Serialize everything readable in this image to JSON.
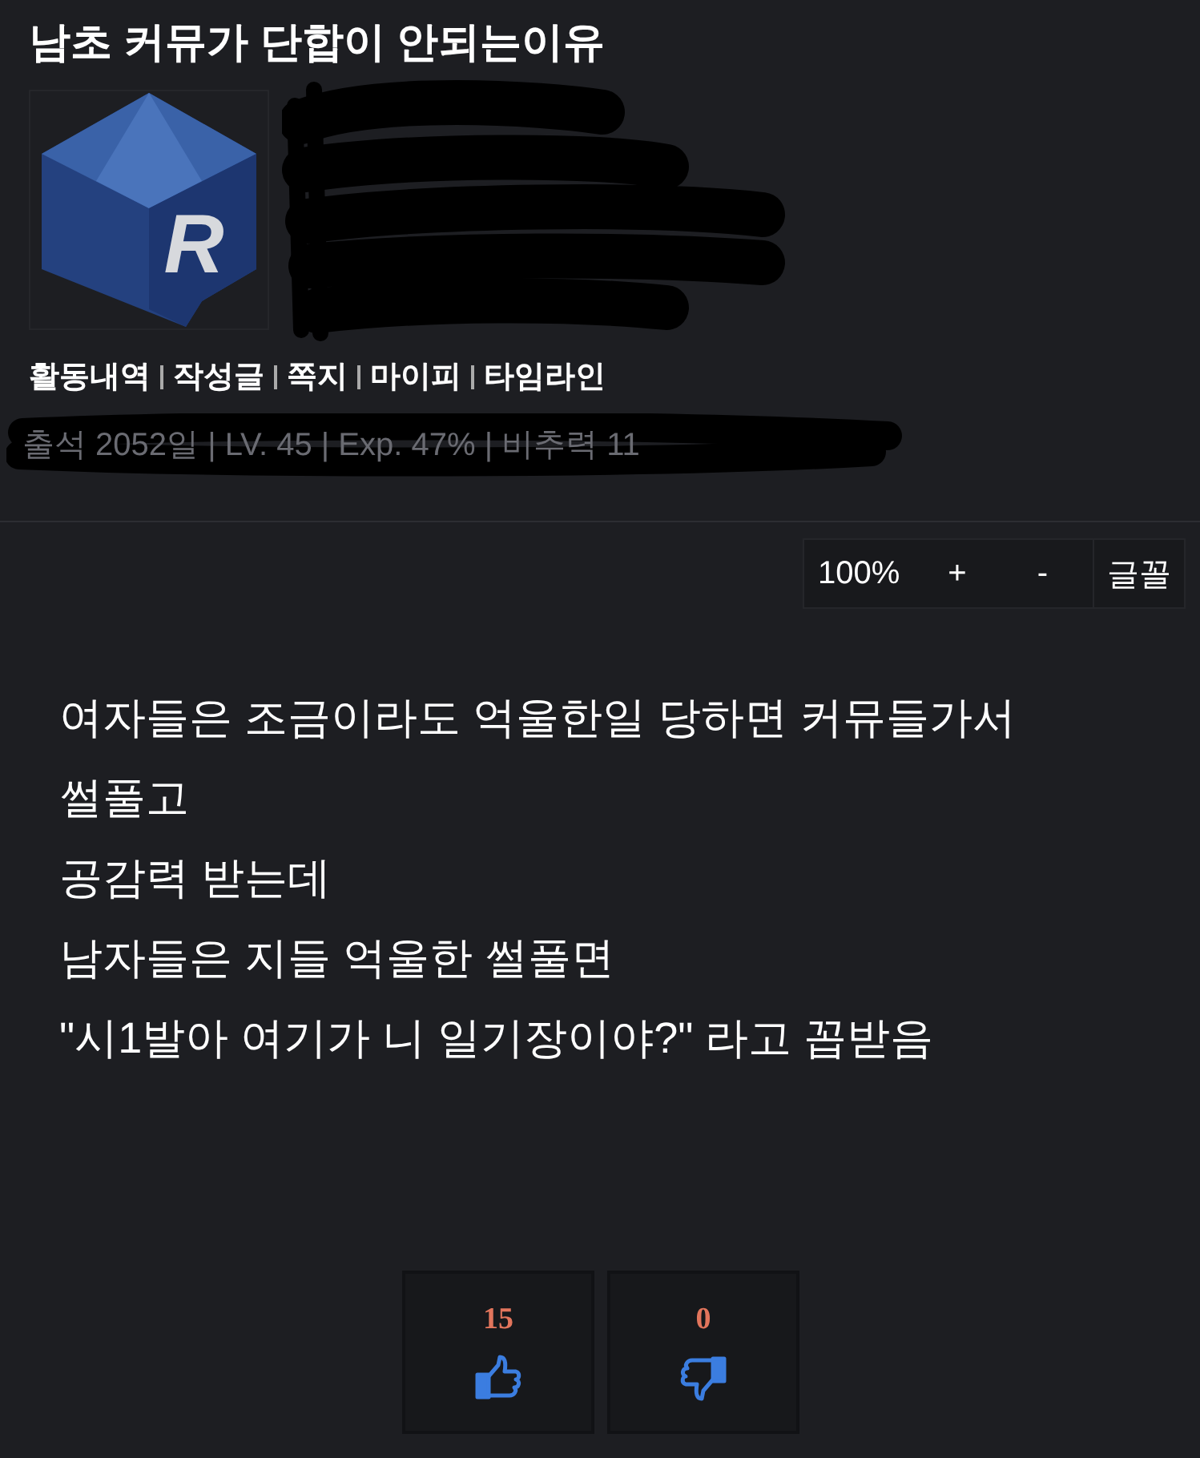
{
  "post": {
    "title": "남초 커뮤가 단합이 안되는이유"
  },
  "author": {
    "avatar_letter": "R",
    "links": [
      "활동내역",
      "작성글",
      "쪽지",
      "마이피",
      "타임라인"
    ],
    "stats": "출석 2052일 | LV. 45 | Exp. 47% | 비추력 11"
  },
  "font_toolbar": {
    "zoom": "100%",
    "buttons": [
      "+",
      "-",
      "글꼴"
    ]
  },
  "body": [
    "여자들은 조금이라도 억울한일 당하면 커뮤들가서",
    "썰풀고",
    "공감력 받는데",
    "남자들은 지들 억울한 썰풀면",
    "\"시1발아 여기가 니 일기장이야?\" 라고 꼽받음"
  ],
  "votes": [
    {
      "kind": "up",
      "count": "15"
    },
    {
      "kind": "down",
      "count": "0"
    }
  ]
}
